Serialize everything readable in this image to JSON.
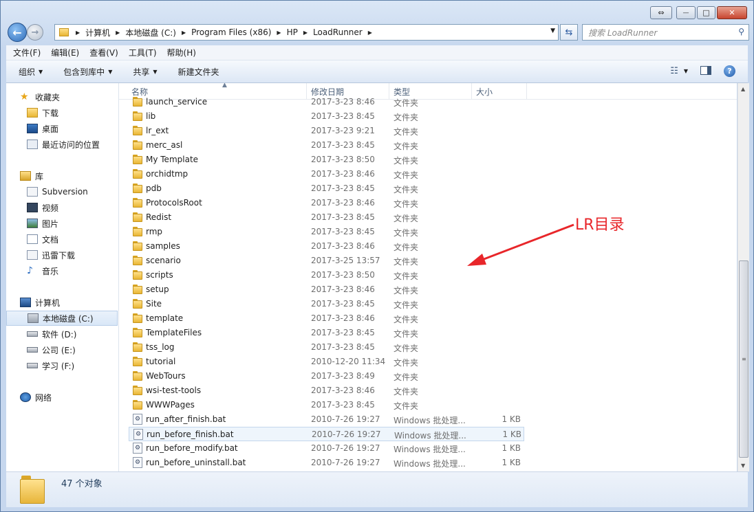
{
  "window": {
    "controls": {
      "minimize": "—",
      "maximize": "□",
      "close": "✕",
      "restore": "⇔"
    }
  },
  "address": {
    "crumbs": [
      "计算机",
      "本地磁盘 (C:)",
      "Program Files (x86)",
      "HP",
      "LoadRunner"
    ]
  },
  "search": {
    "placeholder": "搜索 LoadRunner"
  },
  "menu": [
    "文件(F)",
    "编辑(E)",
    "查看(V)",
    "工具(T)",
    "帮助(H)"
  ],
  "toolbar": {
    "organize": "组织",
    "include_library": "包含到库中",
    "share": "共享",
    "new_folder": "新建文件夹"
  },
  "sidebar": {
    "favorites": {
      "label": "收藏夹",
      "items": [
        "下载",
        "桌面",
        "最近访问的位置"
      ]
    },
    "libraries": {
      "label": "库",
      "items": [
        "Subversion",
        "视频",
        "图片",
        "文档",
        "迅雷下载",
        "音乐"
      ]
    },
    "computer": {
      "label": "计算机",
      "items": [
        "本地磁盘 (C:)",
        "软件 (D:)",
        "公司 (E:)",
        "学习 (F:)"
      ]
    },
    "network": {
      "label": "网络"
    }
  },
  "columns": {
    "name": "名称",
    "date": "修改日期",
    "type": "类型",
    "size": "大小"
  },
  "files": [
    {
      "name": "launch_service",
      "date": "2017-3-23 8:46",
      "type": "文件夹",
      "size": "",
      "kind": "folder"
    },
    {
      "name": "lib",
      "date": "2017-3-23 8:45",
      "type": "文件夹",
      "size": "",
      "kind": "folder"
    },
    {
      "name": "lr_ext",
      "date": "2017-3-23 9:21",
      "type": "文件夹",
      "size": "",
      "kind": "folder"
    },
    {
      "name": "merc_asl",
      "date": "2017-3-23 8:45",
      "type": "文件夹",
      "size": "",
      "kind": "folder"
    },
    {
      "name": "My Template",
      "date": "2017-3-23 8:50",
      "type": "文件夹",
      "size": "",
      "kind": "folder"
    },
    {
      "name": "orchidtmp",
      "date": "2017-3-23 8:46",
      "type": "文件夹",
      "size": "",
      "kind": "folder"
    },
    {
      "name": "pdb",
      "date": "2017-3-23 8:45",
      "type": "文件夹",
      "size": "",
      "kind": "folder"
    },
    {
      "name": "ProtocolsRoot",
      "date": "2017-3-23 8:46",
      "type": "文件夹",
      "size": "",
      "kind": "folder"
    },
    {
      "name": "Redist",
      "date": "2017-3-23 8:45",
      "type": "文件夹",
      "size": "",
      "kind": "folder"
    },
    {
      "name": "rmp",
      "date": "2017-3-23 8:45",
      "type": "文件夹",
      "size": "",
      "kind": "folder"
    },
    {
      "name": "samples",
      "date": "2017-3-23 8:46",
      "type": "文件夹",
      "size": "",
      "kind": "folder"
    },
    {
      "name": "scenario",
      "date": "2017-3-25 13:57",
      "type": "文件夹",
      "size": "",
      "kind": "folder"
    },
    {
      "name": "scripts",
      "date": "2017-3-23 8:50",
      "type": "文件夹",
      "size": "",
      "kind": "folder"
    },
    {
      "name": "setup",
      "date": "2017-3-23 8:46",
      "type": "文件夹",
      "size": "",
      "kind": "folder"
    },
    {
      "name": "Site",
      "date": "2017-3-23 8:45",
      "type": "文件夹",
      "size": "",
      "kind": "folder"
    },
    {
      "name": "template",
      "date": "2017-3-23 8:46",
      "type": "文件夹",
      "size": "",
      "kind": "folder"
    },
    {
      "name": "TemplateFiles",
      "date": "2017-3-23 8:45",
      "type": "文件夹",
      "size": "",
      "kind": "folder"
    },
    {
      "name": "tss_log",
      "date": "2017-3-23 8:45",
      "type": "文件夹",
      "size": "",
      "kind": "folder"
    },
    {
      "name": "tutorial",
      "date": "2010-12-20 11:34",
      "type": "文件夹",
      "size": "",
      "kind": "folder"
    },
    {
      "name": "WebTours",
      "date": "2017-3-23 8:49",
      "type": "文件夹",
      "size": "",
      "kind": "folder"
    },
    {
      "name": "wsi-test-tools",
      "date": "2017-3-23 8:46",
      "type": "文件夹",
      "size": "",
      "kind": "folder"
    },
    {
      "name": "WWWPages",
      "date": "2017-3-23 8:45",
      "type": "文件夹",
      "size": "",
      "kind": "folder"
    },
    {
      "name": "run_after_finish.bat",
      "date": "2010-7-26 19:27",
      "type": "Windows 批处理...",
      "size": "1 KB",
      "kind": "bat"
    },
    {
      "name": "run_before_finish.bat",
      "date": "2010-7-26 19:27",
      "type": "Windows 批处理...",
      "size": "1 KB",
      "kind": "bat",
      "selected": true
    },
    {
      "name": "run_before_modify.bat",
      "date": "2010-7-26 19:27",
      "type": "Windows 批处理...",
      "size": "1 KB",
      "kind": "bat"
    },
    {
      "name": "run_before_uninstall.bat",
      "date": "2010-7-26 19:27",
      "type": "Windows 批处理...",
      "size": "1 KB",
      "kind": "bat"
    }
  ],
  "status": {
    "count": "47 个对象"
  },
  "annotation": {
    "text": "LR目录",
    "color": "#e8262a"
  }
}
